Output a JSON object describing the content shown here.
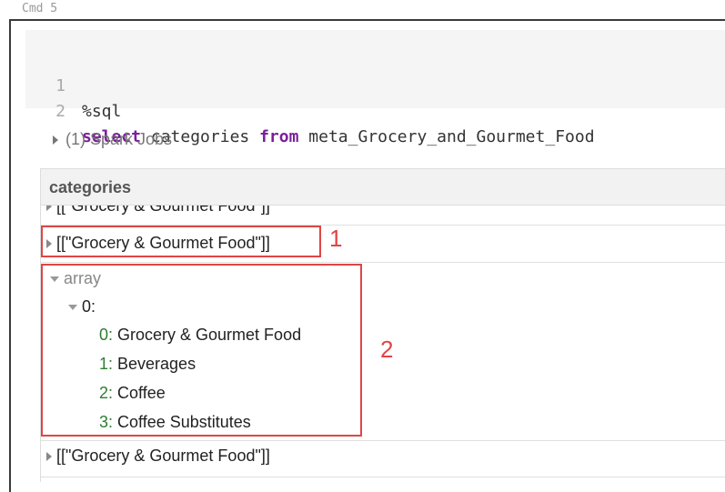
{
  "cell": {
    "label": "Cmd 5"
  },
  "editor": {
    "lines": [
      {
        "num": "1",
        "text": "%sql"
      },
      {
        "num": "2",
        "kw1": "select",
        "mid": " categories ",
        "kw2": "from",
        "tail": " meta_Grocery_and_Gourmet_Food"
      }
    ]
  },
  "spark_jobs": {
    "label": "(1) Spark Jobs"
  },
  "table": {
    "header": "categories",
    "rows": [
      "[[\"Grocery & Gourmet Food\"]]",
      "[[\"Grocery & Gourmet Food\"]]",
      "[[\"Grocery & Gourmet Food\"]]"
    ],
    "expanded": {
      "root_label": "array",
      "child_label": "0:",
      "items": [
        {
          "idx": "0:",
          "value": " Grocery & Gourmet Food"
        },
        {
          "idx": "1:",
          "value": " Beverages"
        },
        {
          "idx": "2:",
          "value": " Coffee"
        },
        {
          "idx": "3:",
          "value": " Coffee Substitutes"
        }
      ]
    }
  },
  "annotations": {
    "label_1": "1",
    "label_2": "2",
    "color": "#e04545"
  }
}
